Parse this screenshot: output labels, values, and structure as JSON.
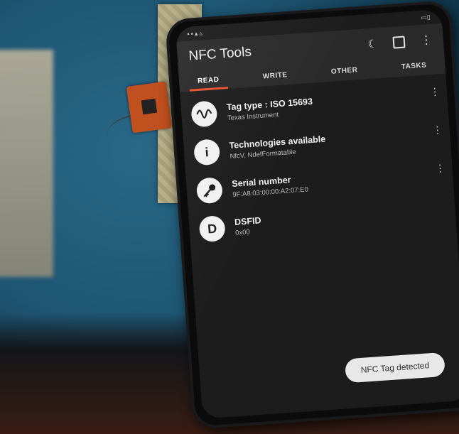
{
  "app": {
    "title": "NFC Tools"
  },
  "tabs": [
    {
      "label": "READ",
      "active": true
    },
    {
      "label": "WRITE",
      "active": false
    },
    {
      "label": "OTHER",
      "active": false
    },
    {
      "label": "TASKS",
      "active": false
    }
  ],
  "icons": {
    "appbar": [
      "moon-icon",
      "square-icon",
      "more-vertical-icon"
    ],
    "rows": [
      "wave-icon",
      "info-icon",
      "key-icon",
      "letter-d-icon"
    ]
  },
  "rows": [
    {
      "title": "Tag type : ISO 15693",
      "subtitle": "Texas Instrument"
    },
    {
      "title": "Technologies available",
      "subtitle": "NfcV, NdefFormatable"
    },
    {
      "title": "Serial number",
      "subtitle": "9F:A8:03:00:00:A2:07:E0"
    },
    {
      "title": "DSFID",
      "subtitle": "0x00"
    }
  ],
  "rowAvatarText": {
    "info": "i",
    "dsfid": "D"
  },
  "toast": {
    "text": "NFC Tag detected"
  },
  "colors": {
    "accent": "#e8512c",
    "screen": "#1c1c1d",
    "appbar": "#2a2a2b"
  }
}
